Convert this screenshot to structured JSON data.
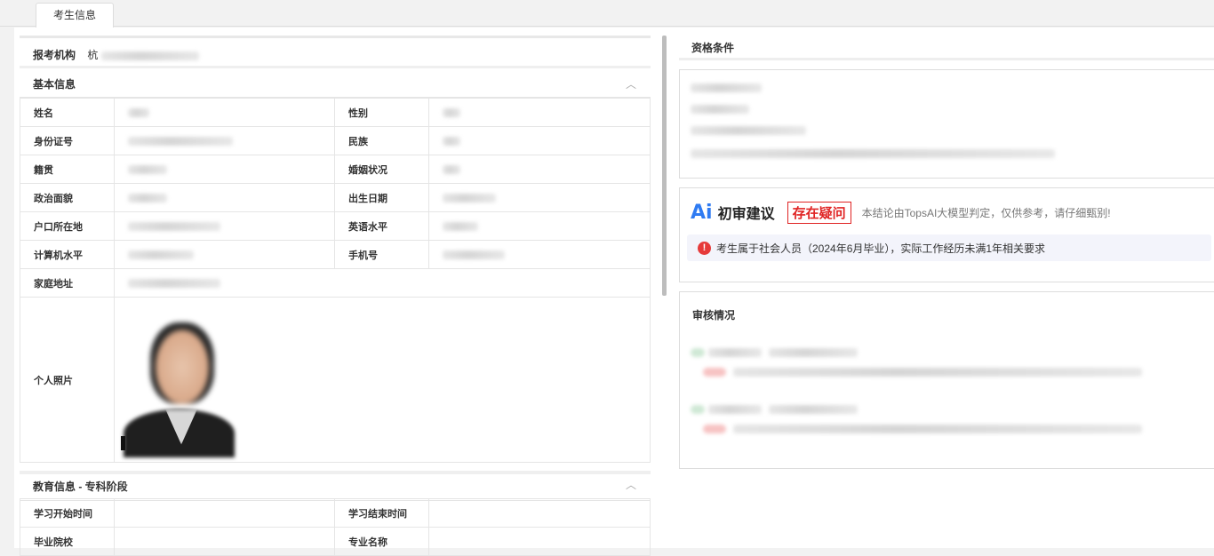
{
  "tabs": [
    {
      "label": "考生信息",
      "active": true
    }
  ],
  "org": {
    "label": "报考机构",
    "value_prefix": "杭"
  },
  "basic": {
    "title": "基本信息",
    "fields": {
      "name": "姓名",
      "gender": "性别",
      "id_number": "身份证号",
      "ethnicity": "民族",
      "native_place": "籍贯",
      "marital_status": "婚姻状况",
      "political_status": "政治面貌",
      "birth_date": "出生日期",
      "household": "户口所在地",
      "english_level": "英语水平",
      "computer_level": "计算机水平",
      "phone": "手机号",
      "home_address": "家庭地址",
      "photo": "个人照片"
    }
  },
  "education": {
    "title": "教育信息 - 专科阶段",
    "fields": {
      "start_time": "学习开始时间",
      "end_time": "学习结束时间",
      "school": "毕业院校",
      "major": "专业名称"
    }
  },
  "qualification": {
    "title": "资格条件"
  },
  "ai": {
    "icon": "Ai",
    "title": "初审建议",
    "badge": "存在疑问",
    "note": "本结论由TopsAI大模型判定，仅供参考，请仔细甄别!",
    "warning_icon": "!",
    "warning": "考生属于社会人员（2024年6月毕业），实际工作经历未满1年相关要求"
  },
  "review": {
    "title": "审核情况"
  },
  "colors": {
    "accent": "#2f7bf2",
    "danger": "#e02424"
  }
}
